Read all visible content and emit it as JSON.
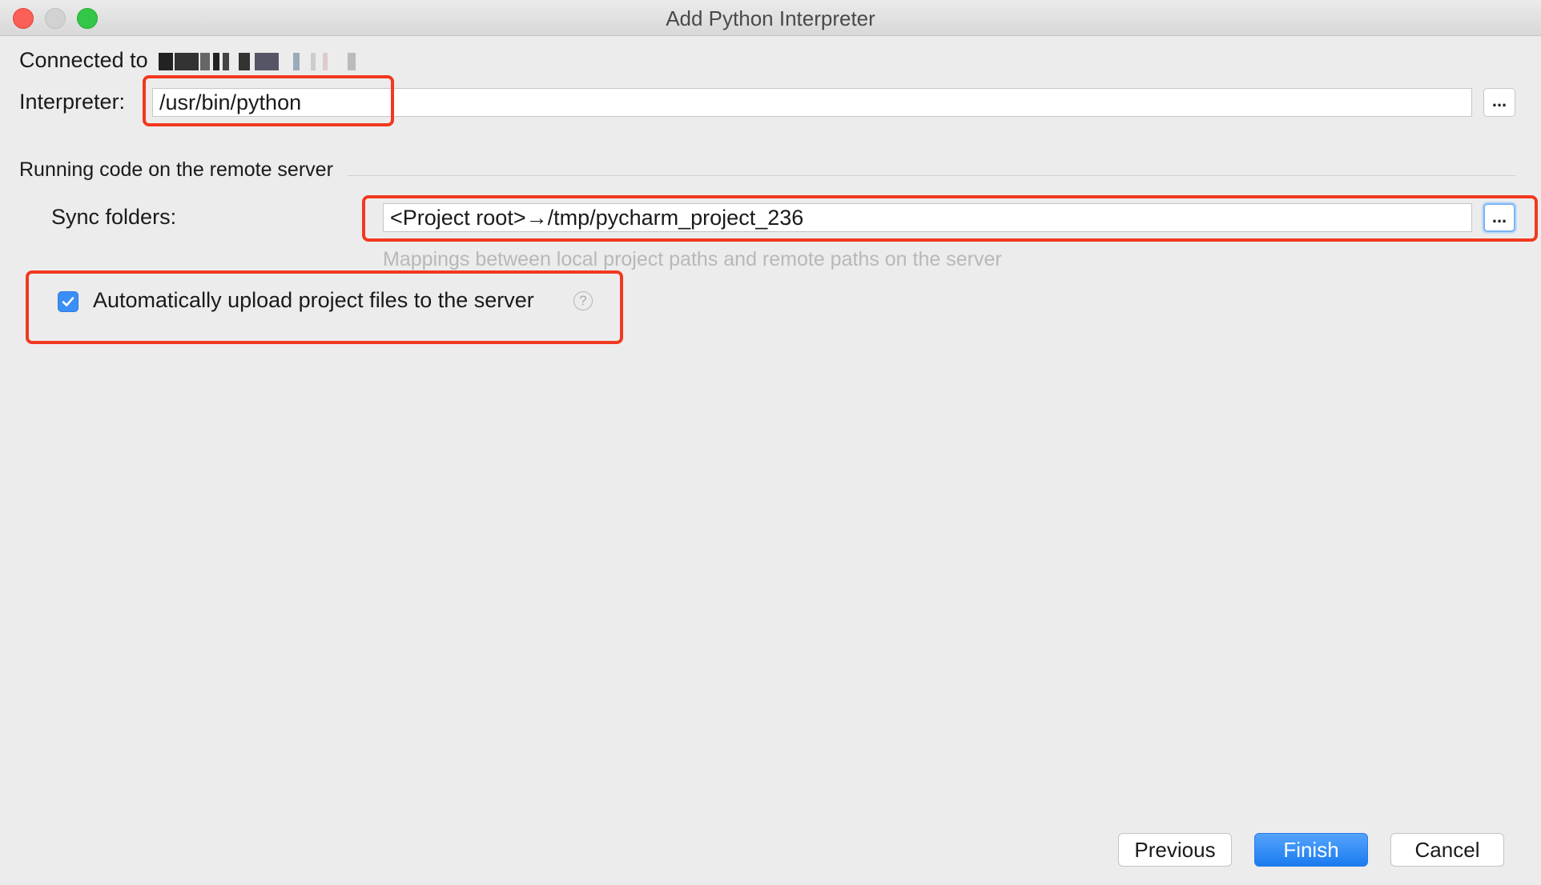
{
  "window": {
    "title": "Add Python Interpreter"
  },
  "connection": {
    "label": "Connected to"
  },
  "interpreter": {
    "label": "Interpreter:",
    "value": "/usr/bin/python",
    "browse_label": "..."
  },
  "remote_section": {
    "heading": "Running code on the remote server",
    "sync_label": "Sync folders:",
    "sync_value": "<Project root>→/tmp/pycharm_project_236",
    "browse_label": "...",
    "hint": "Mappings between local project paths and remote paths on the server"
  },
  "auto_upload": {
    "label": "Automatically upload project files to the server",
    "checked": true,
    "help_glyph": "?"
  },
  "footer": {
    "previous_label": "Previous",
    "finish_label": "Finish",
    "cancel_label": "Cancel"
  },
  "colors": {
    "annotation": "#f1391f",
    "accent": "#1a7cf0",
    "background": "#ececec"
  }
}
